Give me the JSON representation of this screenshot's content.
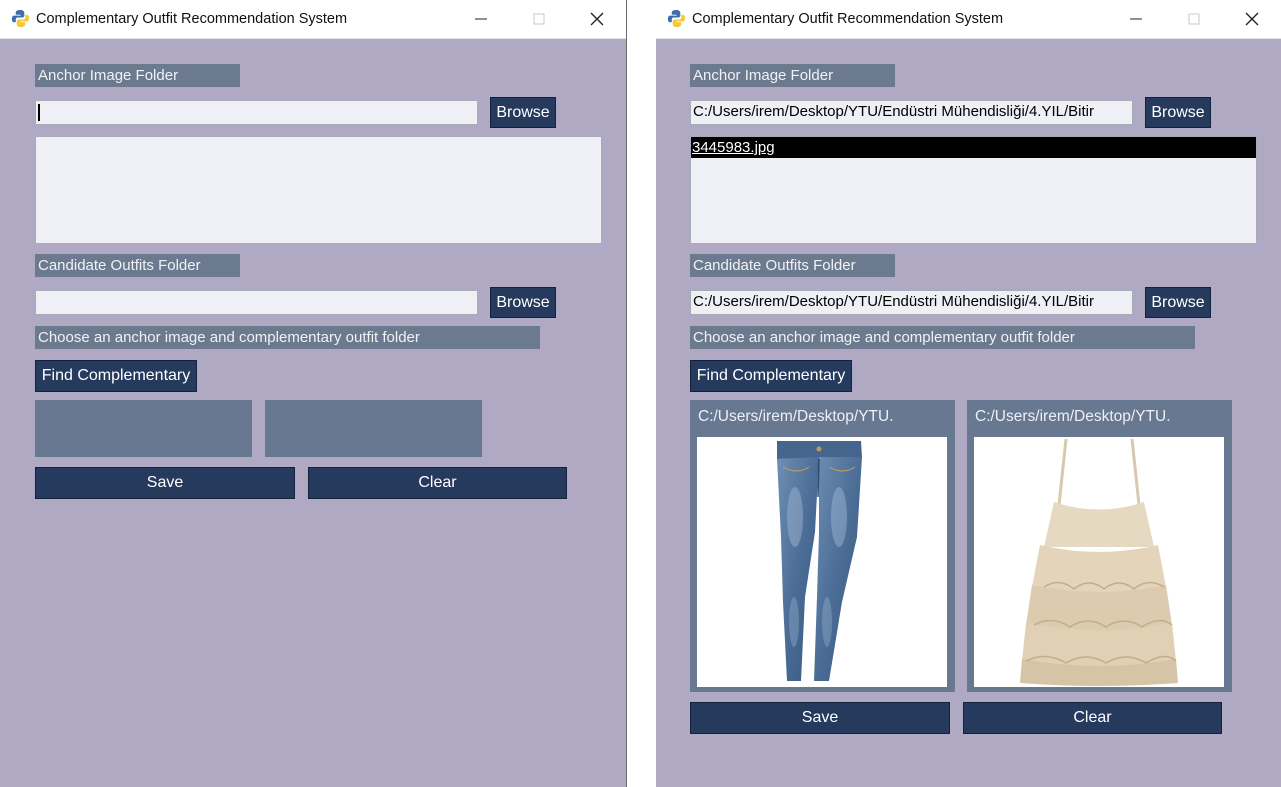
{
  "windows": [
    {
      "title": "Complementary Outfit Recommendation System",
      "anchor_label": "Anchor Image Folder",
      "anchor_path": "",
      "anchor_browse": "Browse",
      "anchor_files": [],
      "candidate_label": "Candidate Outfits Folder",
      "candidate_path": "",
      "candidate_browse": "Browse",
      "status": "Choose an anchor image and complementary outfit folder",
      "find_button": "Find Complementary",
      "results": [],
      "save_button": "Save",
      "clear_button": "Clear"
    },
    {
      "title": "Complementary Outfit Recommendation System",
      "anchor_label": "Anchor Image Folder",
      "anchor_path": "C:/Users/irem/Desktop/YTU/Endüstri Mühendisliği/4.YIL/Bitir",
      "anchor_browse": "Browse",
      "anchor_files": [
        "3445983.jpg"
      ],
      "candidate_label": "Candidate Outfits Folder",
      "candidate_path": "C:/Users/irem/Desktop/YTU/Endüstri Mühendisliği/4.YIL/Bitir",
      "candidate_browse": "Browse",
      "status": "Choose an anchor image and complementary outfit folder",
      "find_button": "Find Complementary",
      "results": [
        {
          "path": "C:/Users/irem/Desktop/YTU.",
          "image": "jeans"
        },
        {
          "path": "C:/Users/irem/Desktop/YTU.",
          "image": "ruffled-top"
        }
      ],
      "save_button": "Save",
      "clear_button": "Clear"
    }
  ],
  "colors": {
    "window_bg": "#afa9c3",
    "label_bg": "#6b7a8f",
    "button_bg": "#253a5c",
    "entry_bg": "#eef0f6",
    "panel_bg": "#687891"
  }
}
